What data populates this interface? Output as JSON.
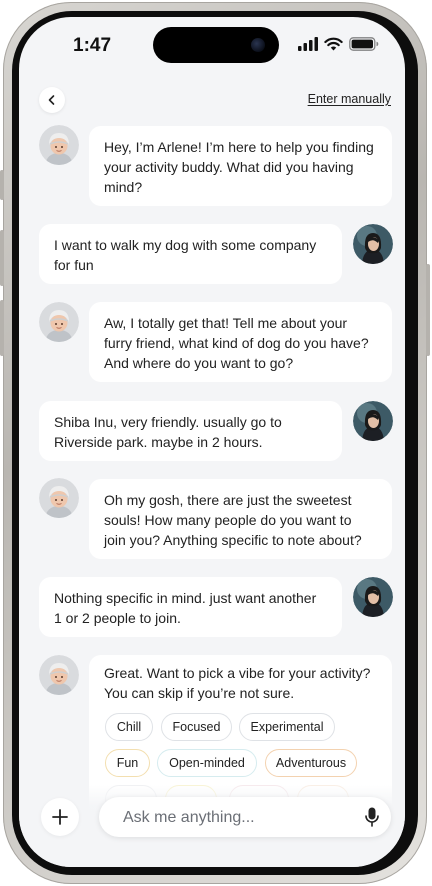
{
  "status_bar": {
    "time": "1:47"
  },
  "header": {
    "enter_manually": "Enter manually"
  },
  "messages": [
    {
      "from": "bot",
      "text": "Hey, I’m Arlene! I’m here to help you finding your activity buddy. What did you having mind?"
    },
    {
      "from": "user",
      "text": "I want to walk my dog with some company for fun"
    },
    {
      "from": "bot",
      "text": "Aw, I totally get that! Tell me about your furry friend, what kind of dog do you have? And where do you want to go?"
    },
    {
      "from": "user",
      "text": "Shiba Inu, very friendly. usually go to Riverside park. maybe in 2 hours."
    },
    {
      "from": "bot",
      "text": "Oh my gosh, there are just the sweetest souls! How many people do you want to join you? Anything specific to note about?"
    },
    {
      "from": "user",
      "text": "Nothing specific in mind. just want another 1 or 2 people to join."
    },
    {
      "from": "bot",
      "text": "Great. Want to pick a vibe for your activity? You can skip if you’re not sure."
    }
  ],
  "vibes": [
    {
      "label": "Chill",
      "color": "#dfe2e6"
    },
    {
      "label": "Focused",
      "color": "#dfe2e6"
    },
    {
      "label": "Experimental",
      "color": "#dfe2e6"
    },
    {
      "label": "Fun",
      "color": "#f3dfb0"
    },
    {
      "label": "Open-minded",
      "color": "#d6ecef"
    },
    {
      "label": "Adventurous",
      "color": "#f3d2b0"
    }
  ],
  "input": {
    "placeholder": "Ask me anything..."
  },
  "icons": {
    "back": "chevron-left-icon",
    "plus": "plus-icon",
    "mic": "microphone-icon",
    "signal": "cellular-signal-icon",
    "wifi": "wifi-icon",
    "battery": "battery-icon"
  }
}
